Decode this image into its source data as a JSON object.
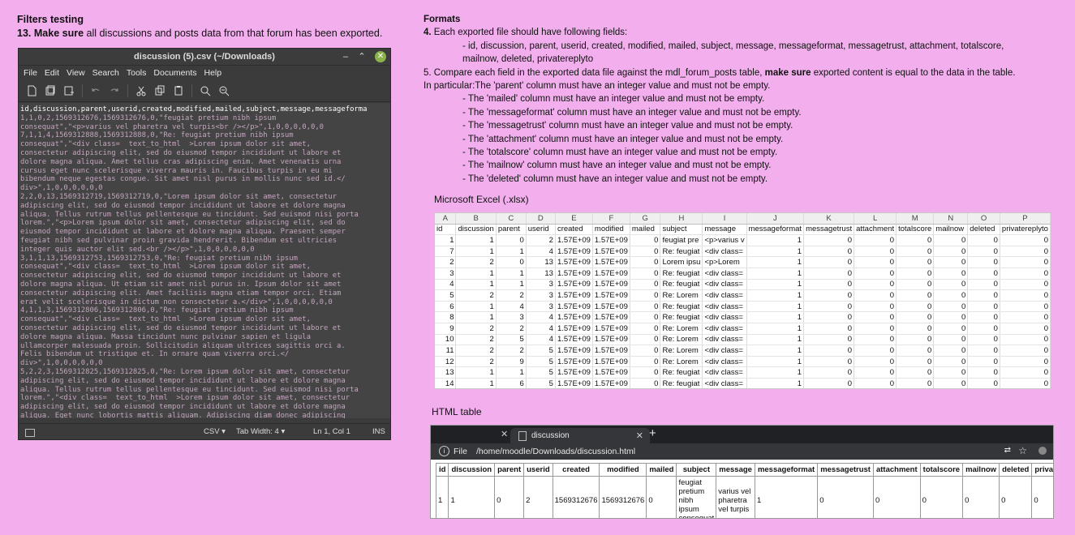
{
  "left": {
    "title": "Filters testing",
    "step_num": "13.",
    "step_bold": "Make sure",
    "step_rest": " all discussions and posts data from that forum has been exported."
  },
  "editor": {
    "title": "discussion (5).csv (~/Downloads)",
    "menu": [
      "File",
      "Edit",
      "View",
      "Search",
      "Tools",
      "Documents",
      "Help"
    ],
    "first_line": "id,discussion,parent,userid,created,modified,mailed,subject,message,messageforma",
    "lines": [
      "1,1,0,2,1569312676,1569312676,0,\"feugiat pretium nibh ipsum",
      "consequat\",\"<p>varius vel pharetra vel turpis<br /></p>\",1,0,0,0,0,0,0",
      "7,1,1,4,1569312888,1569312888,0,\"Re: feugiat pretium nibh ipsum",
      "consequat\",\"<div class=  text_to_html  >Lorem ipsum dolor sit amet,",
      "consectetur adipiscing elit, sed do eiusmod tempor incididunt ut labore et",
      "dolore magna aliqua. Amet tellus cras adipiscing enim. Amet venenatis urna",
      "cursus eget nunc scelerisque viverra mauris in. Faucibus turpis in eu mi",
      "bibendum neque egestas congue. Sit amet nisl purus in mollis nunc sed id.</",
      "div>\",1,0,0,0,0,0,0",
      "2,2,0,13,1569312719,1569312719,0,\"Lorem ipsum dolor sit amet, consectetur",
      "adipiscing elit, sed do eiusmod tempor incididunt ut labore et dolore magna",
      "aliqua. Tellus rutrum tellus pellentesque eu tincidunt. Sed euismod nisi porta",
      "lorem.\",\"<p>Lorem ipsum dolor sit amet, consectetur adipiscing elit, sed do",
      "eiusmod tempor incididunt ut labore et dolore magna aliqua. Praesent semper",
      "feugiat nibh sed pulvinar proin gravida hendrerit. Bibendum est ultricies",
      "integer quis auctor elit sed.<br /></p>\",1,0,0,0,0,0,0",
      "3,1,1,13,1569312753,1569312753,0,\"Re: feugiat pretium nibh ipsum",
      "consequat\",\"<div class=  text_to_html  >Lorem ipsum dolor sit amet,",
      "consectetur adipiscing elit, sed do eiusmod tempor incididunt ut labore et",
      "dolore magna aliqua. Ut etiam sit amet nisl purus in. Ipsum dolor sit amet",
      "consectetur adipiscing elit. Amet facilisis magna etiam tempor orci. Etiam",
      "erat velit scelerisque in dictum non consectetur a.</div>\",1,0,0,0,0,0,0",
      "4,1,1,3,1569312806,1569312806,0,\"Re: feugiat pretium nibh ipsum",
      "consequat\",\"<div class=  text_to_html  >Lorem ipsum dolor sit amet,",
      "consectetur adipiscing elit, sed do eiusmod tempor incididunt ut labore et",
      "dolore magna aliqua. Massa tincidunt nunc pulvinar sapien et ligula",
      "ullamcorper malesuada proin. Sollicitudin aliquam ultrices sagittis orci a.",
      "Felis bibendum ut tristique et. In ornare quam viverra orci.</",
      "div>\",1,0,0,0,0,0,0",
      "5,2,2,3,1569312825,1569312825,0,\"Re: Lorem ipsum dolor sit amet, consectetur",
      "adipiscing elit, sed do eiusmod tempor incididunt ut labore et dolore magna",
      "aliqua. Tellus rutrum tellus pellentesque eu tincidunt. Sed euismod nisi porta",
      "lorem.\",\"<div class=  text_to_html  >Lorem ipsum dolor sit amet, consectetur",
      "adipiscing elit, sed do eiusmod tempor incididunt ut labore et dolore magna",
      "aliqua. Eget nunc lobortis mattis aliquam. Adipiscing diam donec adipiscing"
    ],
    "status": {
      "lang": "CSV ▾",
      "tab": "Tab Width: 4 ▾",
      "pos": "Ln 1, Col 1",
      "ins": "INS"
    }
  },
  "formats": {
    "title": "Formats",
    "step4": "4. Each exported file should have following fields:",
    "fields_line1": "- id, discussion, parent, userid, created, modified, mailed, subject, message, messageformat, messagetrust, attachment, totalscore,",
    "fields_line2": "mailnow, deleted,  privatereplyto",
    "step5_pre": "5. Compare each field in the exported data file against the mdl_forum_posts table, ",
    "step5_bold": "make sure",
    "step5_post": " exported content is equal to the data in the table.",
    "particular": "In particular:The 'parent' column must have an integer value and must not be empty.",
    "rules": [
      "- The 'mailed' column must have an integer value and must not be empty.",
      "- The 'messageformat' column must have an integer value and must not be empty.",
      "- The 'messagetrust' column must have an integer value and must not be empty.",
      "- The 'attachment' column must have an integer value and must not be empty.",
      "- The 'totalscore' column must have an integer value and must not be empty.",
      "- The 'mailnow' column must have an integer value and must not be empty.",
      "- The 'deleted'  column must have an integer value and must not be empty."
    ]
  },
  "excel": {
    "label": "Microsoft Excel (.xlsx)",
    "col_letters": [
      "A",
      "B",
      "C",
      "D",
      "E",
      "F",
      "G",
      "H",
      "I",
      "J",
      "K",
      "L",
      "M",
      "N",
      "O",
      "P"
    ],
    "headers": [
      "id",
      "discussion",
      "parent",
      "userid",
      "created",
      "modified",
      "mailed",
      "subject",
      "message",
      "messageformat",
      "messagetrust",
      "attachment",
      "totalscore",
      "mailnow",
      "deleted",
      "privatereplyto"
    ],
    "rows": [
      [
        "1",
        "1",
        "0",
        "2",
        "1.57E+09",
        "1.57E+09",
        "0",
        "feugiat pre",
        "<p>varius v",
        "1",
        "0",
        "0",
        "0",
        "0",
        "0",
        "0"
      ],
      [
        "7",
        "1",
        "1",
        "4",
        "1.57E+09",
        "1.57E+09",
        "0",
        "Re: feugiat",
        "<div class=",
        "1",
        "0",
        "0",
        "0",
        "0",
        "0",
        "0"
      ],
      [
        "2",
        "2",
        "0",
        "13",
        "1.57E+09",
        "1.57E+09",
        "0",
        "Lorem ipsu",
        "<p>Lorem",
        "1",
        "0",
        "0",
        "0",
        "0",
        "0",
        "0"
      ],
      [
        "3",
        "1",
        "1",
        "13",
        "1.57E+09",
        "1.57E+09",
        "0",
        "Re: feugiat",
        "<div class=",
        "1",
        "0",
        "0",
        "0",
        "0",
        "0",
        "0"
      ],
      [
        "4",
        "1",
        "1",
        "3",
        "1.57E+09",
        "1.57E+09",
        "0",
        "Re: feugiat",
        "<div class=",
        "1",
        "0",
        "0",
        "0",
        "0",
        "0",
        "0"
      ],
      [
        "5",
        "2",
        "2",
        "3",
        "1.57E+09",
        "1.57E+09",
        "0",
        "Re: Lorem",
        "<div class=",
        "1",
        "0",
        "0",
        "0",
        "0",
        "0",
        "0"
      ],
      [
        "6",
        "1",
        "4",
        "3",
        "1.57E+09",
        "1.57E+09",
        "0",
        "Re: feugiat",
        "<div class=",
        "1",
        "0",
        "0",
        "0",
        "0",
        "0",
        "0"
      ],
      [
        "8",
        "1",
        "3",
        "4",
        "1.57E+09",
        "1.57E+09",
        "0",
        "Re: feugiat",
        "<div class=",
        "1",
        "0",
        "0",
        "0",
        "0",
        "0",
        "0"
      ],
      [
        "9",
        "2",
        "2",
        "4",
        "1.57E+09",
        "1.57E+09",
        "0",
        "Re: Lorem",
        "<div class=",
        "1",
        "0",
        "0",
        "0",
        "0",
        "0",
        "0"
      ],
      [
        "10",
        "2",
        "5",
        "4",
        "1.57E+09",
        "1.57E+09",
        "0",
        "Re: Lorem",
        "<div class=",
        "1",
        "0",
        "0",
        "0",
        "0",
        "0",
        "0"
      ],
      [
        "11",
        "2",
        "2",
        "5",
        "1.57E+09",
        "1.57E+09",
        "0",
        "Re: Lorem",
        "<div class=",
        "1",
        "0",
        "0",
        "0",
        "0",
        "0",
        "0"
      ],
      [
        "12",
        "2",
        "9",
        "5",
        "1.57E+09",
        "1.57E+09",
        "0",
        "Re: Lorem",
        "<div class=",
        "1",
        "0",
        "0",
        "0",
        "0",
        "0",
        "0"
      ],
      [
        "13",
        "1",
        "1",
        "5",
        "1.57E+09",
        "1.57E+09",
        "0",
        "Re: feugiat",
        "<div class=",
        "1",
        "0",
        "0",
        "0",
        "0",
        "0",
        "0"
      ],
      [
        "14",
        "1",
        "6",
        "5",
        "1.57E+09",
        "1.57E+09",
        "0",
        "Re: feugiat",
        "<div class=",
        "1",
        "0",
        "0",
        "0",
        "0",
        "0",
        "0"
      ]
    ]
  },
  "html_table": {
    "label": "HTML table",
    "tab_title": "discussion",
    "file_label": "File",
    "url": "/home/moodle/Downloads/discussion.html",
    "headers": [
      "id",
      "discussion",
      "parent",
      "userid",
      "created",
      "modified",
      "mailed",
      "subject",
      "message",
      "messageformat",
      "messagetrust",
      "attachment",
      "totalscore",
      "mailnow",
      "deleted",
      "privatereplyto"
    ],
    "row": [
      "1",
      "1",
      "0",
      "2",
      "1569312676",
      "1569312676",
      "0",
      "feugiat pretium nibh ipsum consequat",
      "varius vel pharetra vel turpis",
      "1",
      "0",
      "0",
      "0",
      "0",
      "0",
      "0"
    ]
  }
}
